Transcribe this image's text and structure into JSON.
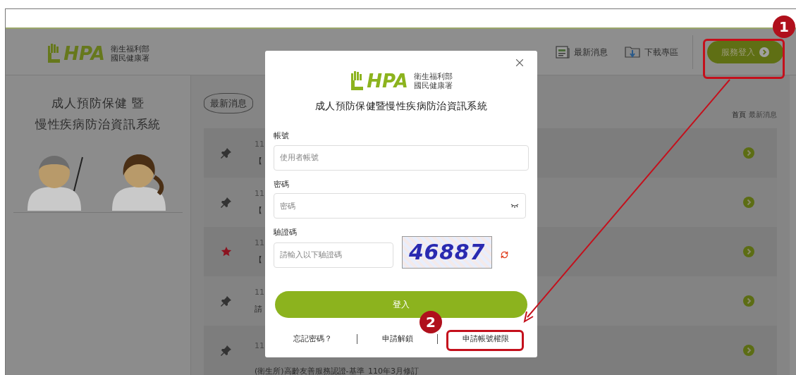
{
  "header": {
    "logo": {
      "mark": "HPA",
      "org_lines": [
        "衛生福利部",
        "國民健康署"
      ]
    },
    "nav": [
      {
        "kind": "news",
        "label": "最新消息"
      },
      {
        "kind": "download",
        "label": "下載專區"
      }
    ],
    "login_button": "服務登入"
  },
  "sidebar": {
    "title_lines": [
      "成人預防保健 暨",
      "慢性疾病防治資訊系統"
    ]
  },
  "news": {
    "heading": "最新消息",
    "breadcrumb": [
      "首頁",
      "最新消息"
    ],
    "items": [
      {
        "kind": "pin",
        "date": "11",
        "title": "【"
      },
      {
        "kind": "pin",
        "date": "11",
        "title": "【"
      },
      {
        "kind": "star",
        "date": "11",
        "title": "【"
      },
      {
        "kind": "pin",
        "date": "11",
        "title": "請"
      },
      {
        "kind": "pin",
        "date": "11",
        "title": "(衛生所)高齡友善服務認證-基準_110年3月修訂"
      }
    ]
  },
  "modal": {
    "logo": {
      "mark": "HPA",
      "org_lines": [
        "衛生福利部",
        "國民健康署"
      ]
    },
    "title": "成人預防保健暨慢性疾病防治資訊系統",
    "fields": [
      {
        "kind": "text",
        "label": "帳號",
        "placeholder": "使用者帳號"
      },
      {
        "kind": "password",
        "label": "密碼",
        "placeholder": "密碼"
      },
      {
        "kind": "captcha",
        "label": "驗證碼",
        "placeholder": "請輸入以下驗證碼",
        "captcha_text": "46887"
      }
    ],
    "submit": "登入",
    "links": [
      "忘記密碼？",
      "申請解鎖",
      "申請帳號權限"
    ]
  },
  "annotations": [
    {
      "number": "1"
    },
    {
      "number": "2"
    }
  ]
}
